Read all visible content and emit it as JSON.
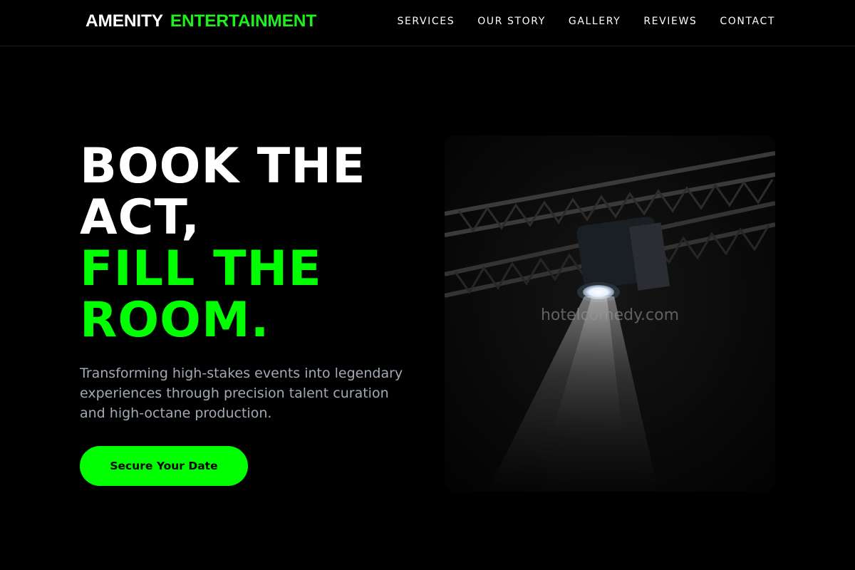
{
  "brand": {
    "name_part1": "AMENITY",
    "name_part2": "ENTERTAINMENT",
    "accent_color": "#00ff00"
  },
  "nav": {
    "items": [
      {
        "label": "SERVICES"
      },
      {
        "label": "OUR STORY"
      },
      {
        "label": "GALLERY"
      },
      {
        "label": "REVIEWS"
      },
      {
        "label": "CONTACT"
      }
    ]
  },
  "hero": {
    "title_line1": "BOOK THE",
    "title_line2": "ACT,",
    "title_line3": "FILL THE",
    "title_line4": "ROOM.",
    "subtitle": "Transforming high-stakes events into legendary experiences through precision talent curation and high-octane production.",
    "cta_label": "Secure Your Date"
  },
  "media": {
    "watermark": "hotelcomedy.com",
    "subject": "spotlight-on-truss-photo"
  }
}
